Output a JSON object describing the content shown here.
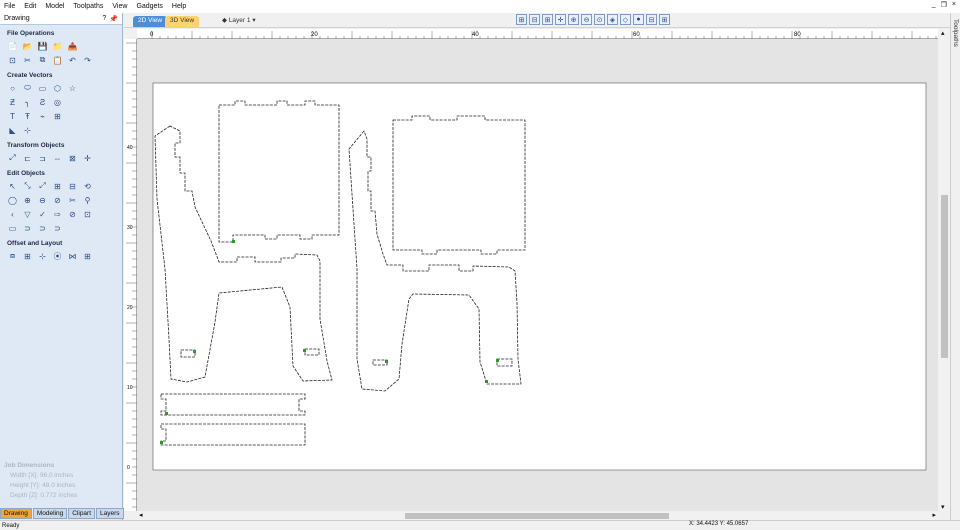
{
  "menu": [
    "File",
    "Edit",
    "Model",
    "Toolpaths",
    "View",
    "Gadgets",
    "Help"
  ],
  "window_controls": {
    "minimize": "_",
    "restore": "❐",
    "close": "×"
  },
  "panel": {
    "title": "Drawing",
    "head_icons": [
      "?",
      "📌"
    ],
    "sections": [
      {
        "title": "File Operations",
        "rows": [
          [
            "📄",
            "📂",
            "💾",
            "📁",
            "📤"
          ],
          [
            "⊡",
            "✂",
            "⧉",
            "📋",
            "↶",
            "↷"
          ]
        ]
      },
      {
        "title": "Create Vectors",
        "rows": [
          [
            "○",
            "⬭",
            "▭",
            "⬡",
            "☆"
          ],
          [
            "Ƶ",
            "╮",
            "Ƨ",
            "◎"
          ],
          [
            "T",
            "Ŧ",
            "⌁",
            "⊞"
          ],
          [
            "◣",
            "⊹"
          ]
        ]
      },
      {
        "title": "Transform Objects",
        "rows": [
          [
            "⤢",
            "⊏",
            "⊐",
            "⇔",
            "⊠",
            "✛"
          ]
        ]
      },
      {
        "title": "Edit Objects",
        "rows": [
          [
            "↖",
            "⤡",
            "⤢",
            "⊞",
            "⊟",
            "⟲"
          ],
          [
            "◯",
            "⊕",
            "⊖",
            "⊘",
            "✂",
            "⚲"
          ],
          [
            "‹",
            "▽",
            "✓",
            "⇨",
            "⊘",
            "⊡"
          ],
          [
            "▭",
            "⊃",
            "⊃",
            "⊃"
          ]
        ]
      },
      {
        "title": "Offset and Layout",
        "rows": [
          [
            "⧈",
            "⊞",
            "⊹",
            "⦿",
            "⋈",
            "⊞"
          ]
        ]
      }
    ]
  },
  "job_dimensions": {
    "title": "Job Dimensions",
    "width": "Width  [X]: 96.0 inches",
    "height": "Height [Y]: 48.0 inches",
    "depth": "Depth  [Z]: 0.772 inches"
  },
  "bottom_tabs": [
    "Drawing",
    "Modeling",
    "Clipart",
    "Layers"
  ],
  "view_tabs": {
    "view2d": "2D View",
    "view3d": "3D View"
  },
  "layer": {
    "icon": "◆",
    "label": "Layer 1",
    "arrow": "▾"
  },
  "toolbar_icons": [
    "⊞",
    "⊟",
    "⊞",
    "✛",
    "⊕",
    "⊖",
    "⊙",
    "◈",
    "◇",
    "●",
    "⊟",
    "⊞"
  ],
  "ruler_h_labels": [
    "0",
    "20",
    "40",
    "60",
    "80"
  ],
  "ruler_v_labels": [
    "0",
    "10",
    "20",
    "30",
    "40"
  ],
  "side_strip_label": "Toolpaths",
  "status": {
    "left": "Ready",
    "coords": "X: 34.4423 Y: 45.0657"
  },
  "scroll_arrows": {
    "up": "▴",
    "down": "▾",
    "left": "◂",
    "right": "▸"
  }
}
